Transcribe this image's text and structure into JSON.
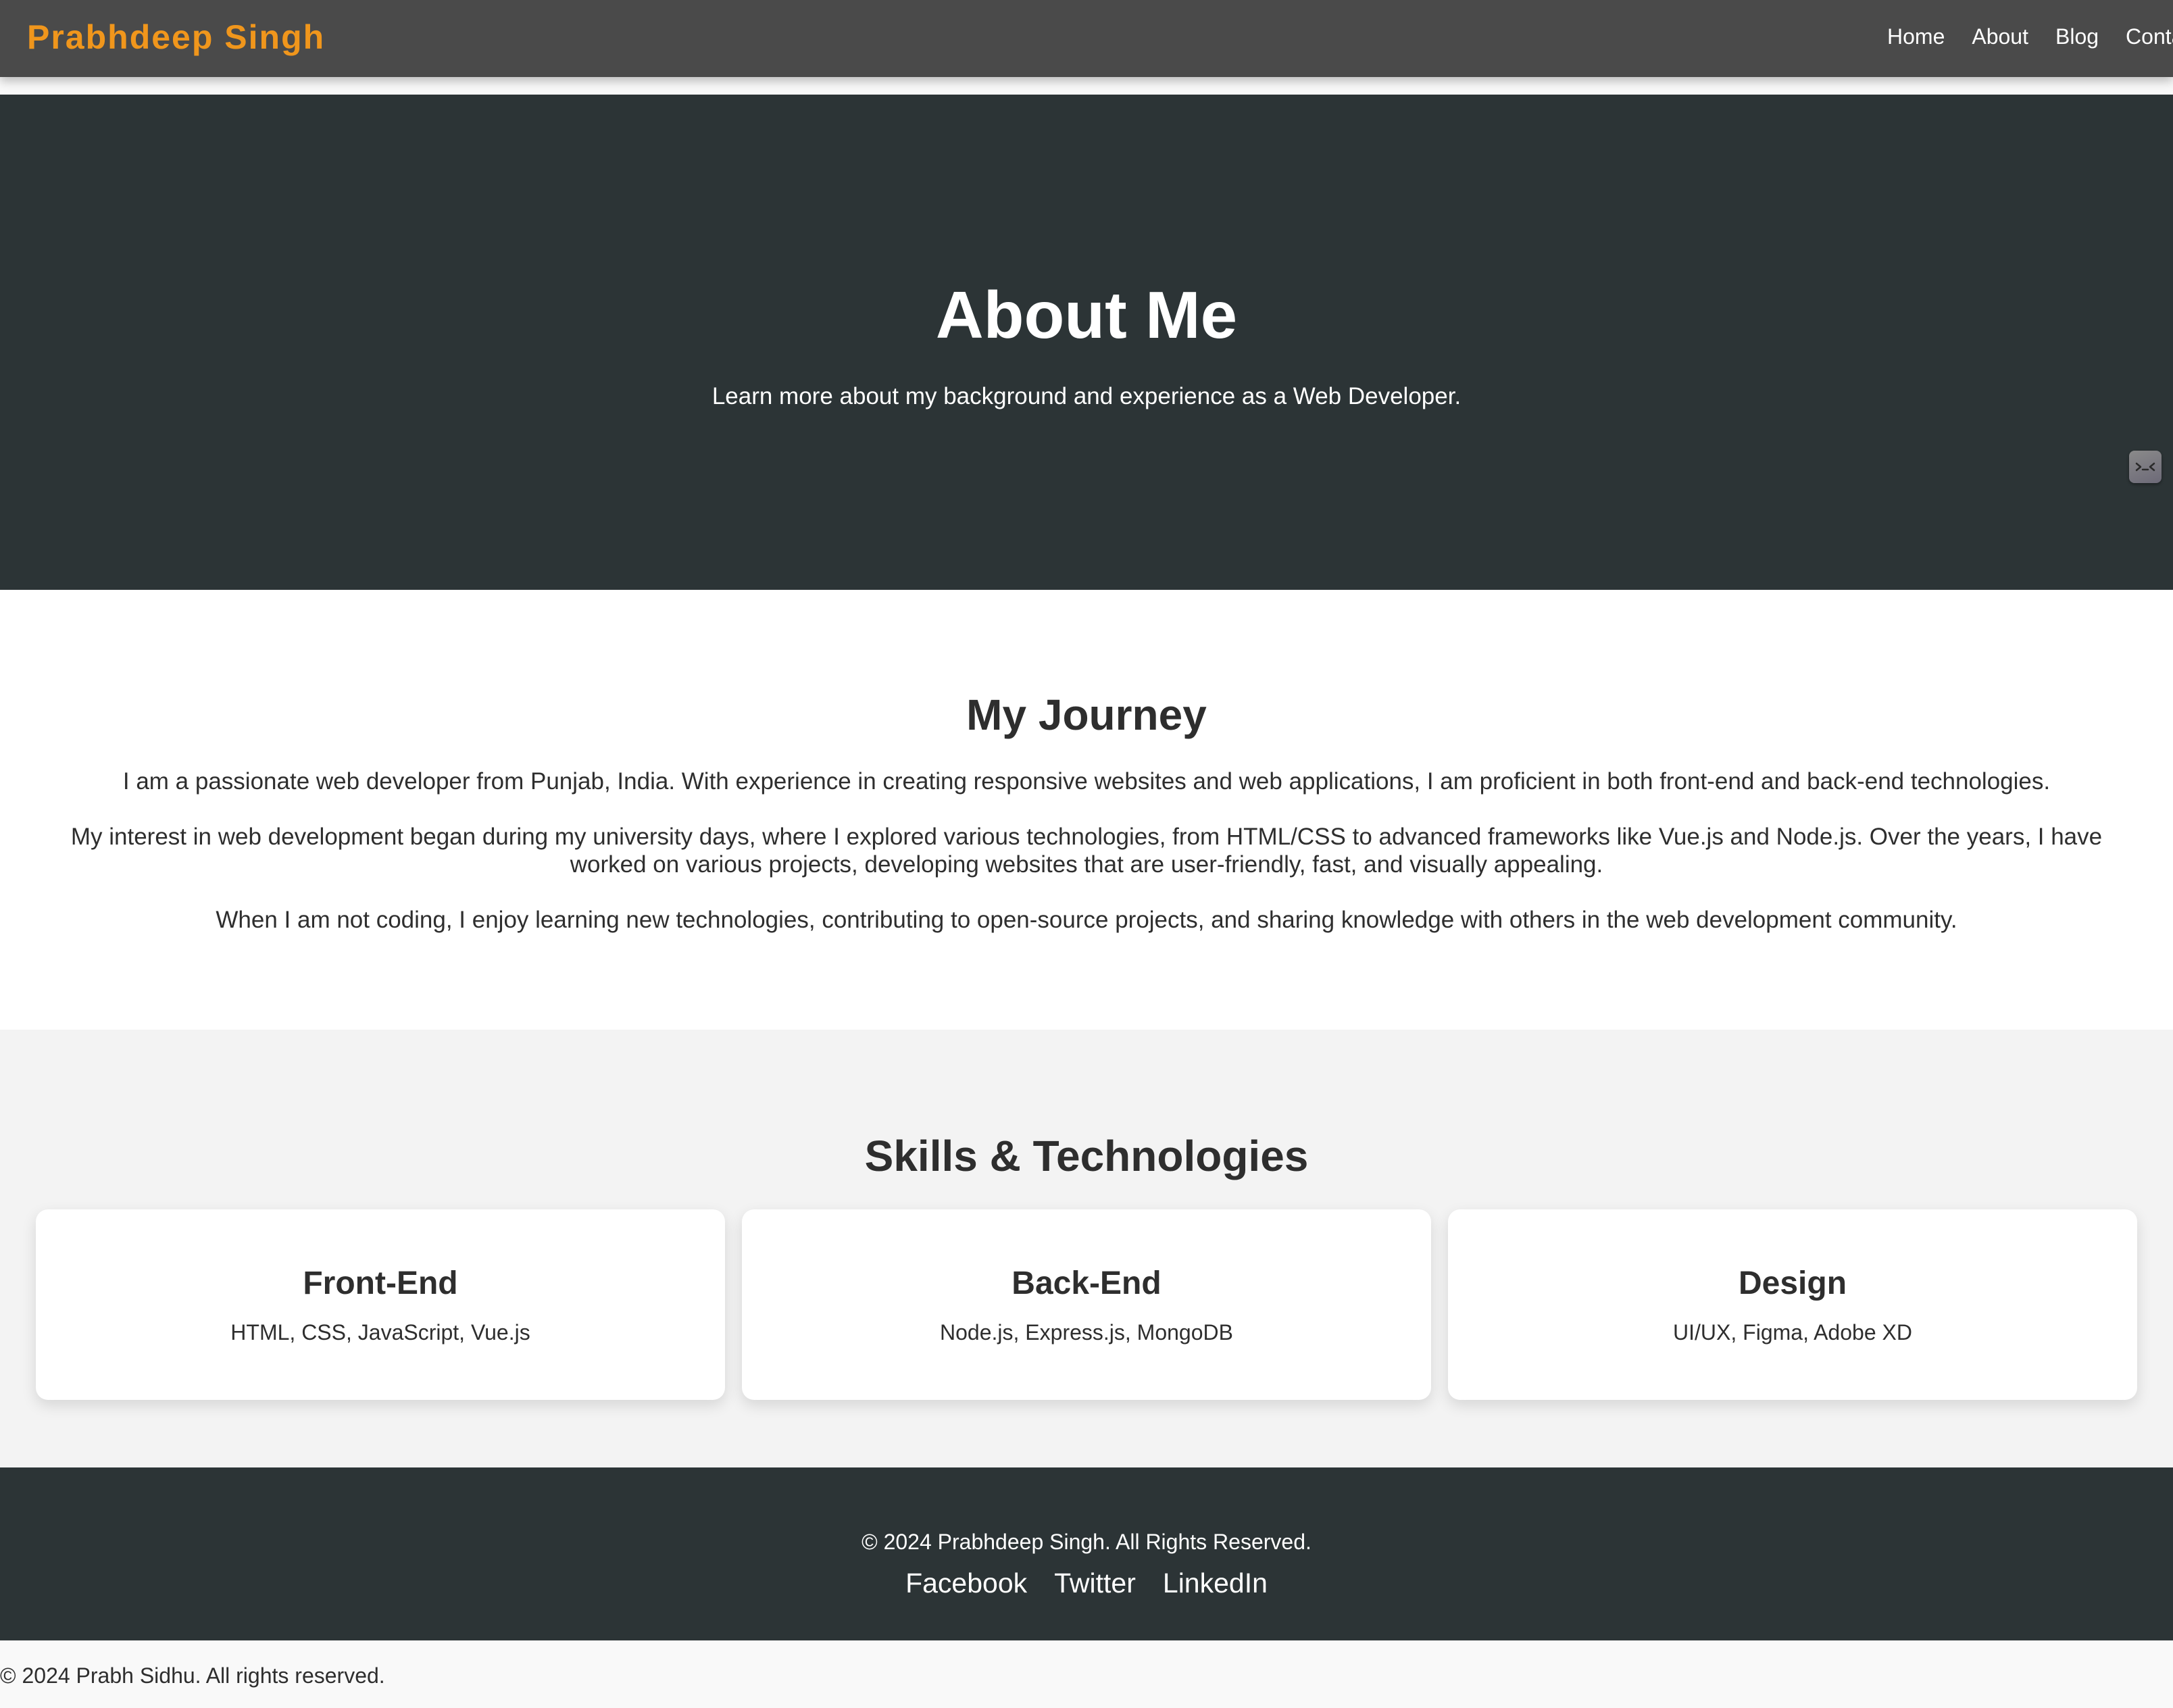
{
  "navbar": {
    "brand": "Prabhdeep Singh",
    "links": [
      "Home",
      "About",
      "Blog",
      "Conta"
    ]
  },
  "hero": {
    "title": "About Me",
    "subtitle": "Learn more about my background and experience as a Web Developer.",
    "badge_icon": "terminal-face-icon"
  },
  "journey": {
    "title": "My Journey",
    "paragraphs": [
      "I am a passionate web developer from Punjab, India. With experience in creating responsive websites and web applications, I am proficient in both front-end and back-end technologies.",
      "My interest in web development began during my university days, where I explored various technologies, from HTML/CSS to advanced frameworks like Vue.js and Node.js. Over the years, I have worked on various projects, developing websites that are user-friendly, fast, and visually appealing.",
      "When I am not coding, I enjoy learning new technologies, contributing to open-source projects, and sharing knowledge with others in the web development community."
    ]
  },
  "skills": {
    "title": "Skills & Technologies",
    "cards": [
      {
        "title": "Front-End",
        "text": "HTML, CSS, JavaScript, Vue.js"
      },
      {
        "title": "Back-End",
        "text": "Node.js, Express.js, MongoDB"
      },
      {
        "title": "Design",
        "text": "UI/UX, Figma, Adobe XD"
      }
    ]
  },
  "footer": {
    "copyright": "© 2024 Prabhdeep Singh. All Rights Reserved.",
    "social": [
      "Facebook",
      "Twitter",
      "LinkedIn"
    ]
  },
  "bottom_note": "© 2024 Prabh Sidhu. All rights reserved.",
  "colors": {
    "brand": "#f0961c",
    "navbar": "#4a4a4a",
    "dark_section": "#2c3436",
    "light_section": "#f3f3f3"
  }
}
